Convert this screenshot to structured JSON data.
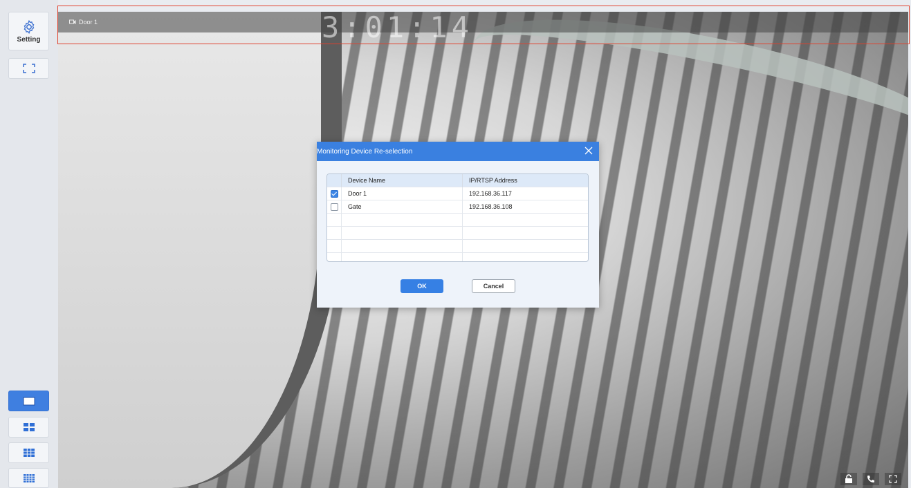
{
  "sidebar": {
    "setting_label": "Setting",
    "icons": [
      "gear-icon",
      "fullscreen-icon",
      "layout-1-icon",
      "layout-4-icon",
      "layout-9-icon",
      "layout-16-icon"
    ],
    "active_layout": "layout-1",
    "accent": "#3f7fe0"
  },
  "video": {
    "camera_name": "Door 1",
    "clock_text": "3:01:14",
    "bottom_icons": [
      "unlock-icon",
      "call-icon",
      "fullscreen-icon"
    ]
  },
  "dialog": {
    "title": "Monitoring Device Re-selection",
    "columns": [
      "Device Name",
      "IP/RTSP Address"
    ],
    "rows": [
      {
        "checked": true,
        "name": "Door 1",
        "address": "192.168.36.117"
      },
      {
        "checked": false,
        "name": "Gate",
        "address": "192.168.36.108"
      }
    ],
    "ok_label": "OK",
    "cancel_label": "Cancel",
    "header_color": "#3a80e0"
  }
}
